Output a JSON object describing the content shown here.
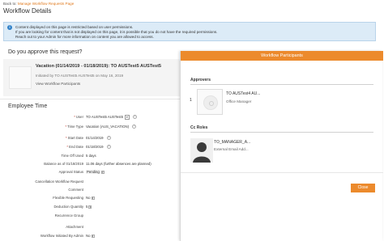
{
  "header": {
    "back_prefix": "Back to:",
    "back_link": "Manage Workflow Requests Page",
    "title": "Workflow Details"
  },
  "info_message": {
    "icon": "info-icon",
    "lines": [
      "Content displayed on this page is restricted based on user permissions.",
      "If you are looking for content that is not displayed on this page, it is possible that you do not have the required permissions.",
      "Reach out to your Admin for more information on content you are allowed to access."
    ]
  },
  "approve_section": {
    "title": "Do you approve this request?",
    "request_title": "Vacation (01/14/2019 - 01/18/2019): TO AUSTest5 AUSTest5",
    "initiated_by": "Initiated by TO AUSTest5 AUSTest5 on May 16, 2019",
    "view_participants_link": "View Workflow Participants"
  },
  "employee_time": {
    "title": "Employee Time",
    "fields": [
      {
        "label": "User",
        "required": true,
        "value": "TO AUSTest5 AUSTest5",
        "tag": "▾",
        "help": true
      },
      {
        "label": "Time Type",
        "required": true,
        "value": "Vacation (AUS_VACATION)",
        "help": true
      },
      {
        "label": "Start Date",
        "required": true,
        "value": "01/14/2019",
        "help": true
      },
      {
        "label": "End Date",
        "required": true,
        "value": "01/18/2019",
        "help": true
      },
      {
        "label": "Time Off Used",
        "required": false,
        "value": "5 days"
      },
      {
        "label": "Balance as of 01/18/2019",
        "required": false,
        "value": "11.06 days (further absences are planned)"
      },
      {
        "label": "Approval Status",
        "required": false,
        "value": "Pending",
        "dropdown": true
      },
      {
        "label": "Cancellation Workflow Request",
        "required": false,
        "value": ""
      },
      {
        "label": "Comment",
        "required": false,
        "value": ""
      },
      {
        "label": "Flexible Requesting",
        "required": false,
        "value": "No",
        "dropdown": true
      },
      {
        "label": "Deduction Quantity",
        "required": false,
        "value": "5",
        "dropdown": true
      },
      {
        "label": "Recurrence Group",
        "required": false,
        "value": ""
      },
      {
        "label": "Attachment",
        "required": false,
        "value": ""
      },
      {
        "label": "Workflow Initiated By Admin",
        "required": false,
        "value": "No",
        "dropdown": true
      }
    ]
  },
  "participants_modal": {
    "title": "Workflow Participants",
    "approvers_label": "Approvers",
    "approvers": [
      {
        "step": "1",
        "name": "TO AUSTest4 AU...",
        "role": "Office Manager"
      }
    ],
    "cc_label": "Cc Roles",
    "cc_roles": [
      {
        "name": "TO_MANAGER_A...",
        "role": "External Email Add..."
      }
    ],
    "close_label": "Close"
  },
  "colors": {
    "accent": "#ec8a2c",
    "info_bg": "#dcebf7",
    "link": "#e07a1f"
  }
}
